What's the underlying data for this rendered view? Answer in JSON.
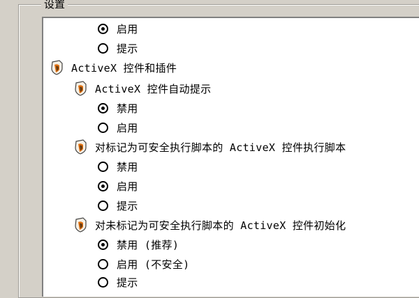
{
  "window": {
    "group_label": "设置"
  },
  "settings": {
    "top_options": [
      {
        "label": "启用",
        "checked": true
      },
      {
        "label": "提示",
        "checked": false
      }
    ],
    "category": {
      "label": "ActiveX 控件和插件",
      "icon": "settings-shield-icon",
      "items": [
        {
          "label": "ActiveX 控件自动提示",
          "icon": "settings-shield-icon",
          "options": [
            {
              "label": "禁用",
              "checked": true
            },
            {
              "label": "启用",
              "checked": false
            }
          ]
        },
        {
          "label": "对标记为可安全执行脚本的 ActiveX 控件执行脚本",
          "icon": "settings-shield-icon",
          "options": [
            {
              "label": "禁用",
              "checked": false
            },
            {
              "label": "启用",
              "checked": true
            },
            {
              "label": "提示",
              "checked": false
            }
          ]
        },
        {
          "label": "对未标记为可安全执行脚本的 ActiveX 控件初始化",
          "icon": "settings-shield-icon",
          "options": [
            {
              "label": "禁用 (推荐)",
              "checked": true
            },
            {
              "label": "启用 (不安全)",
              "checked": false
            },
            {
              "label": "提示",
              "checked": false
            }
          ]
        }
      ]
    }
  }
}
